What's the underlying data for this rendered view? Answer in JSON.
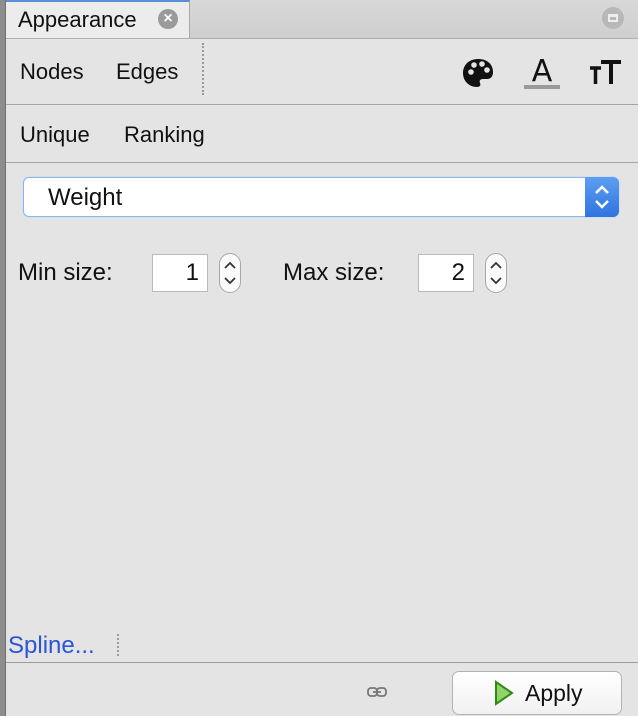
{
  "window": {
    "tab_title": "Appearance"
  },
  "element_tabs": {
    "nodes": "Nodes",
    "edges": "Edges"
  },
  "toolbar_icons": [
    "palette-icon",
    "label-color-icon",
    "text-size-icon"
  ],
  "mode_tabs": {
    "unique": "Unique",
    "ranking": "Ranking"
  },
  "attribute_select": {
    "selected": "Weight"
  },
  "size": {
    "min_label": "Min size:",
    "min_value": "1",
    "max_label": "Max size:",
    "max_value": "2"
  },
  "footer": {
    "spline_link": "Spline...",
    "apply_label": "Apply"
  },
  "colors": {
    "accent": "#2f73e0",
    "link": "#2b55d6",
    "apply_icon": "#3aa41c"
  }
}
